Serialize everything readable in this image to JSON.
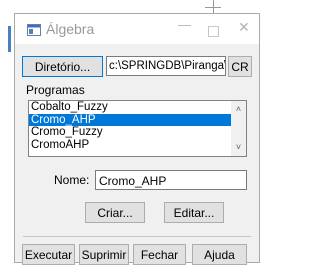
{
  "window": {
    "title": "Álgebra"
  },
  "window_controls": {
    "minimize": "—",
    "close": "✕"
  },
  "directory": {
    "button_label": "Diretório...",
    "path_value": "c:\\SPRINGDB\\Piranga\\Pi",
    "cr_label": "CR"
  },
  "programs": {
    "label": "Programas",
    "items": [
      {
        "label": "Cobalto_Fuzzy",
        "selected": false
      },
      {
        "label": "Cromo_AHP",
        "selected": true
      },
      {
        "label": "Cromo_Fuzzy",
        "selected": false
      },
      {
        "label": "CromoAHP",
        "selected": false
      }
    ]
  },
  "name": {
    "label": "Nome:",
    "value": "Cromo_AHP"
  },
  "actions": {
    "create": "Criar...",
    "edit": "Editar..."
  },
  "footer": {
    "execute": "Executar",
    "delete": "Suprimir",
    "close": "Fechar",
    "help": "Ajuda"
  },
  "colors": {
    "selection": "#0078d7",
    "focus_border": "#0078d7",
    "button_bg": "#e1e1e1",
    "dialog_bg": "#f0f0f0"
  }
}
